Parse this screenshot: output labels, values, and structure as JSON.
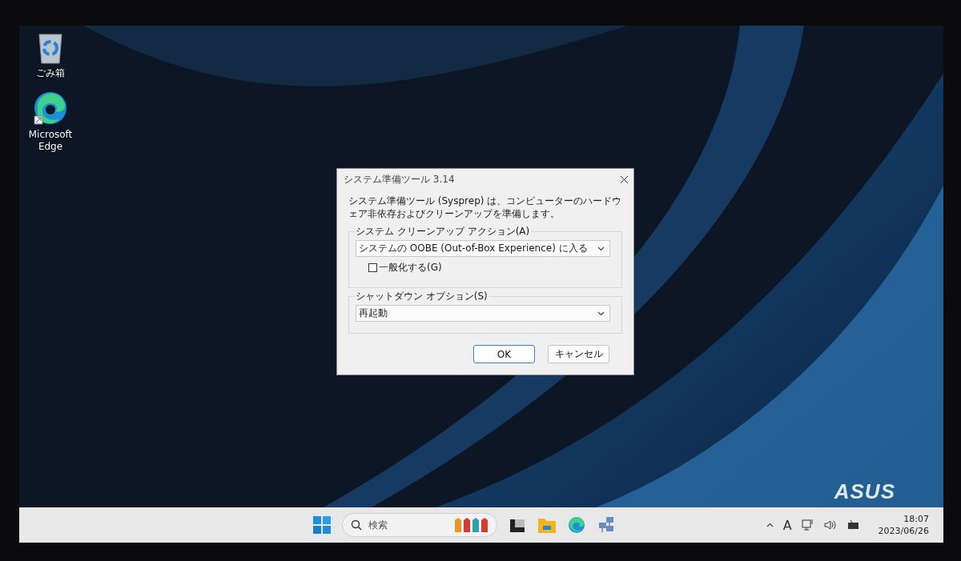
{
  "desktop": {
    "icons": [
      {
        "kind": "recycle",
        "label": "ごみ箱"
      },
      {
        "kind": "edge",
        "label": "Microsoft Edge"
      }
    ],
    "logo": "ASUS"
  },
  "dialog": {
    "title": "システム準備ツール 3.14",
    "description": "システム準備ツール (Sysprep) は、コンピューターのハードウェア非依存およびクリーンアップを準備します。",
    "groups": [
      {
        "label": "システム クリーンアップ アクション(A)",
        "value": "システムの OOBE (Out-of-Box Experience) に入る",
        "checkbox": {
          "label": "一般化する(G)",
          "checked": false
        }
      },
      {
        "label": "シャットダウン オプション(S)",
        "value": "再起動"
      }
    ],
    "buttons": [
      {
        "label": "OK",
        "default": true
      },
      {
        "label": "キャンセル",
        "default": false
      }
    ]
  },
  "taskbar": {
    "search": {
      "placeholder": "検索"
    },
    "ime": "A",
    "time": "18:07",
    "date": "2023/06/26"
  }
}
